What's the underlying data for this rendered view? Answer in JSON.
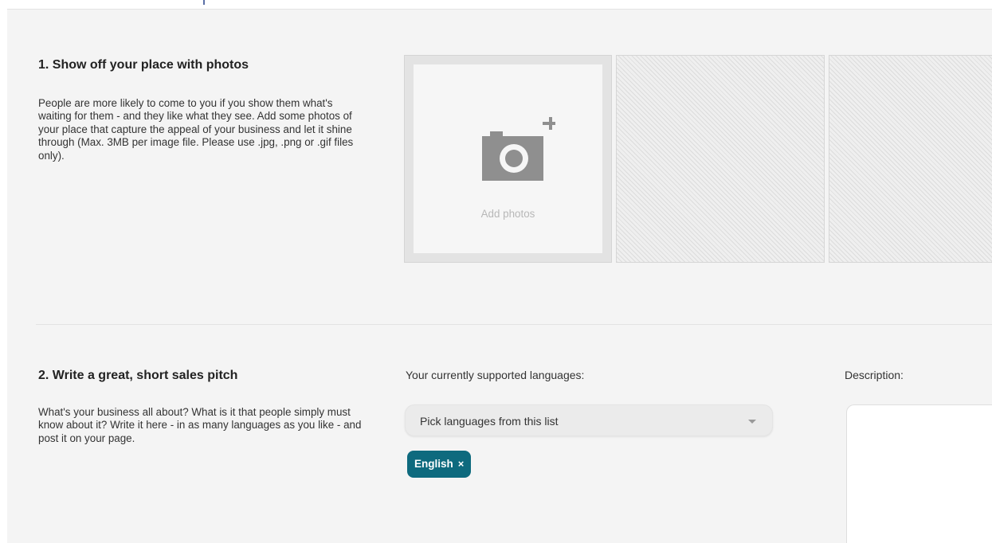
{
  "section1": {
    "title": "1. Show off your place with photos",
    "text": "People are more likely to come to you if you show them what's waiting for them - and they like what they see. Add some photos of your place that capture the appeal of your business and let it shine through (Max. 3MB per image file. Please use .jpg, .png or .gif files only).",
    "add_photos_label": "Add photos",
    "add_photos_icon": "camera-plus-icon"
  },
  "section2": {
    "title": "2. Write a great, short sales pitch",
    "text": "What's your business all about? What is it that people simply must know about it? Write it here - in as many languages as you like - and post it on your page.",
    "languages_label": "Your currently supported languages:",
    "languages_select": {
      "selected_text": "Pick languages from this list",
      "caret_icon": "chevron-down-icon"
    },
    "language_tags": [
      {
        "label": "English",
        "remove": "×"
      }
    ],
    "description_label": "Description:",
    "description_value": ""
  },
  "colors": {
    "panel_bg": "#f4f4f4",
    "tag_bg": "#0e6a7e",
    "accent_top": "#5b6fa6"
  }
}
